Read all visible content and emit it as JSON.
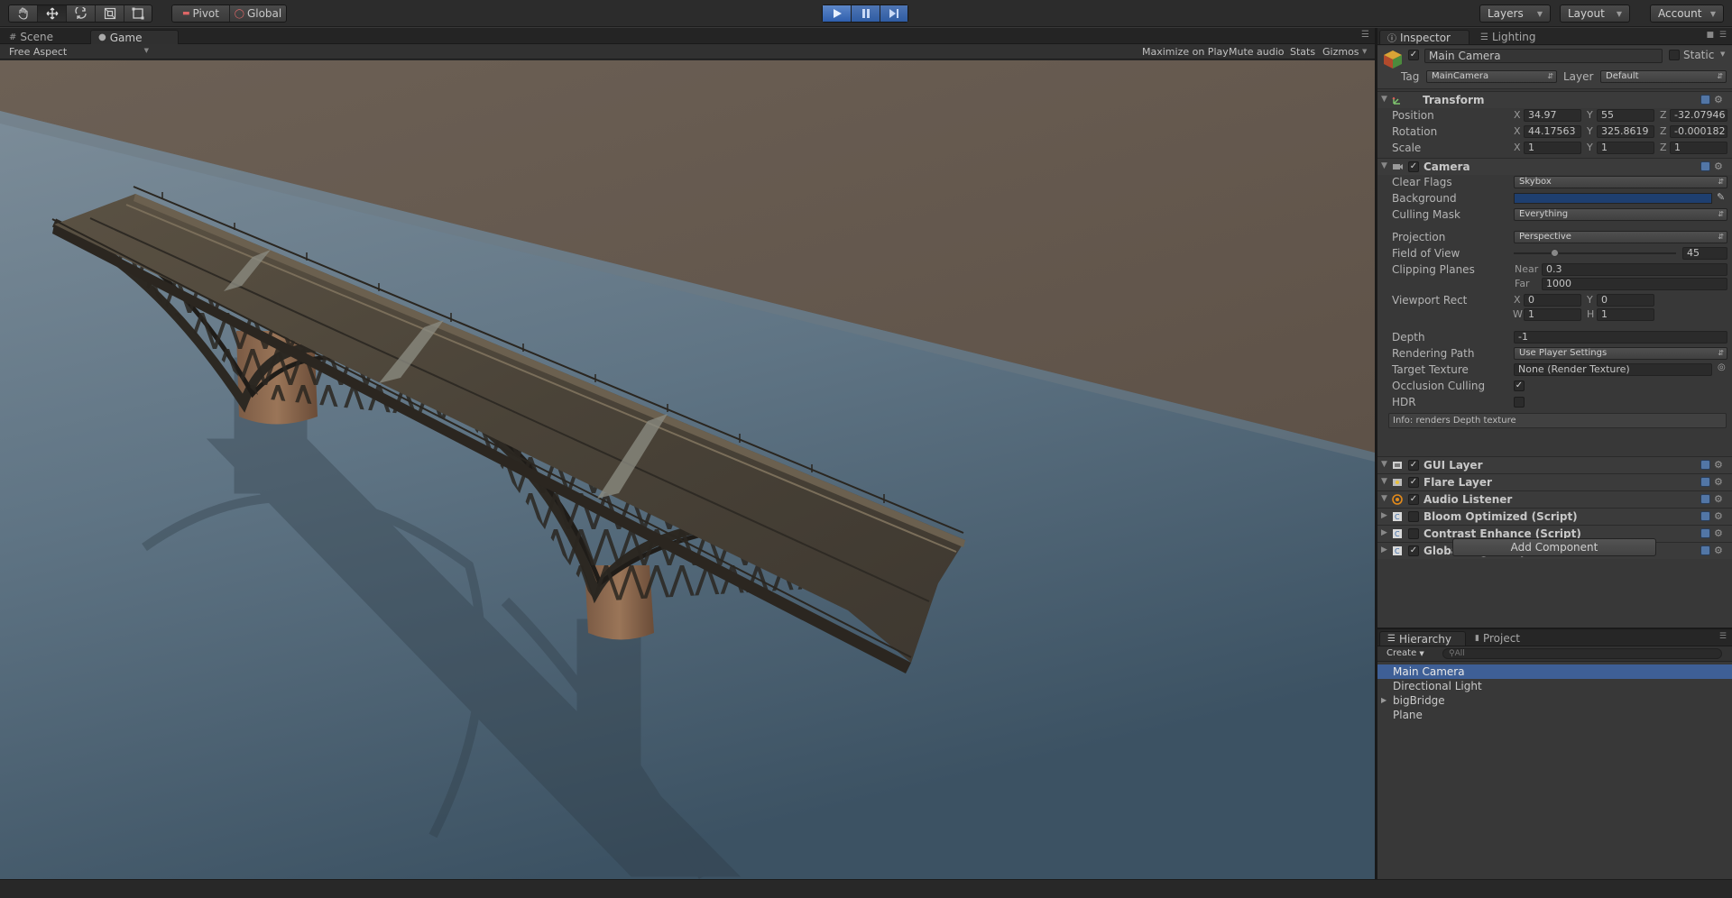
{
  "toolbar": {
    "tools": [
      "hand-tool",
      "move-tool",
      "rotate-tool",
      "scale-tool",
      "rect-tool"
    ],
    "pivot_label": "Pivot",
    "global_label": "Global",
    "play_label": "Play",
    "pause_label": "Pause",
    "step_label": "Step",
    "layers_label": "Layers",
    "layout_label": "Layout",
    "account_label": "Account"
  },
  "scene_panel": {
    "tabs": [
      {
        "label": "Scene"
      },
      {
        "label": "Game"
      }
    ],
    "aspect": "Free Aspect",
    "maximize_on_play": "Maximize on Play",
    "mute_audio": "Mute audio",
    "stats": "Stats",
    "gizmos": "Gizmos"
  },
  "inspector": {
    "tabs": [
      {
        "label": "Inspector"
      },
      {
        "label": "Lighting"
      }
    ],
    "object_name": "Main Camera",
    "static_label": "Static",
    "tag_label": "Tag",
    "tag_value": "MainCamera",
    "layer_label": "Layer",
    "layer_value": "Default",
    "transform": {
      "title": "Transform",
      "position": {
        "label": "Position",
        "x": "34.97",
        "y": "55",
        "z": "-32.07946"
      },
      "rotation": {
        "label": "Rotation",
        "x": "44.17563",
        "y": "325.8619",
        "z": "-0.000182"
      },
      "scale": {
        "label": "Scale",
        "x": "1",
        "y": "1",
        "z": "1"
      }
    },
    "camera": {
      "title": "Camera",
      "clear_flags": {
        "label": "Clear Flags",
        "value": "Skybox"
      },
      "background": {
        "label": "Background",
        "color": "#1e3f70"
      },
      "culling_mask": {
        "label": "Culling Mask",
        "value": "Everything"
      },
      "projection": {
        "label": "Projection",
        "value": "Perspective"
      },
      "fov": {
        "label": "Field of View",
        "value": "45",
        "fraction": 0.25
      },
      "clipping_planes": {
        "label": "Clipping Planes",
        "near_label": "Near",
        "near": "0.3",
        "far_label": "Far",
        "far": "1000"
      },
      "viewport_rect": {
        "label": "Viewport Rect",
        "x": "0",
        "y": "0",
        "w": "1",
        "h": "1"
      },
      "depth": {
        "label": "Depth",
        "value": "-1"
      },
      "rendering_path": {
        "label": "Rendering Path",
        "value": "Use Player Settings"
      },
      "target_texture": {
        "label": "Target Texture",
        "value": "None (Render Texture)"
      },
      "occlusion_culling": {
        "label": "Occlusion Culling",
        "checked": true
      },
      "hdr": {
        "label": "HDR",
        "checked": false
      },
      "info": "Info: renders Depth texture"
    },
    "components": [
      {
        "title": "GUI Layer",
        "enabled": true
      },
      {
        "title": "Flare Layer",
        "enabled": true
      },
      {
        "title": "Audio Listener",
        "enabled": true
      },
      {
        "title": "Bloom Optimized (Script)",
        "enabled": false
      },
      {
        "title": "Contrast Enhance (Script)",
        "enabled": false
      },
      {
        "title": "Global Fog (Script)",
        "enabled": true
      }
    ],
    "add_component": "Add Component"
  },
  "hierarchy": {
    "tabs": [
      {
        "label": "Hierarchy"
      },
      {
        "label": "Project"
      }
    ],
    "create_label": "Create",
    "search_placeholder": "All",
    "items": [
      {
        "label": "Main Camera",
        "selected": true
      },
      {
        "label": "Directional Light"
      },
      {
        "label": "bigBridge",
        "expandable": true
      },
      {
        "label": "Plane"
      }
    ]
  },
  "colors": {
    "accent_play": "#3d74c6",
    "selection": "#3e5f96",
    "background_swatch": "#1e3f70"
  }
}
